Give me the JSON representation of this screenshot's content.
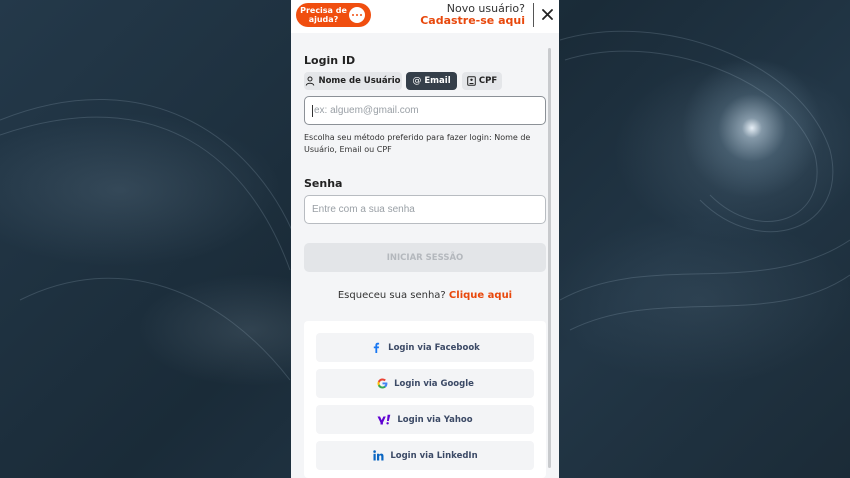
{
  "header": {
    "help_label": "Precisa de ajuda?",
    "signup_prompt": "Novo usuário?",
    "signup_link": "Cadastre-se aqui"
  },
  "login": {
    "section_label": "Login ID",
    "methods": [
      {
        "label": "Nome de Usuário",
        "icon": "user-icon",
        "active": false
      },
      {
        "label": "Email",
        "icon": "at-icon",
        "active": true
      },
      {
        "label": "CPF",
        "icon": "id-card-icon",
        "active": false
      }
    ],
    "email_placeholder": "ex: alguem@gmail.com",
    "helper_text": "Escolha seu método preferido para fazer login: Nome de Usuário, Email ou CPF"
  },
  "password": {
    "section_label": "Senha",
    "placeholder": "Entre com a sua senha"
  },
  "submit_label": "INICIAR SESSÃO",
  "forgot": {
    "prompt": "Esqueceu sua senha?",
    "link": "Clique aqui"
  },
  "social": [
    {
      "label": "Login via Facebook",
      "icon": "facebook-icon"
    },
    {
      "label": "Login via Google",
      "icon": "google-icon"
    },
    {
      "label": "Login via Yahoo",
      "icon": "yahoo-icon"
    },
    {
      "label": "Login via LinkedIn",
      "icon": "linkedin-icon"
    }
  ],
  "colors": {
    "accent": "#e8480c",
    "help_button": "#f04e0f",
    "active_tab": "#353f4a",
    "social_text": "#3c4a66"
  }
}
